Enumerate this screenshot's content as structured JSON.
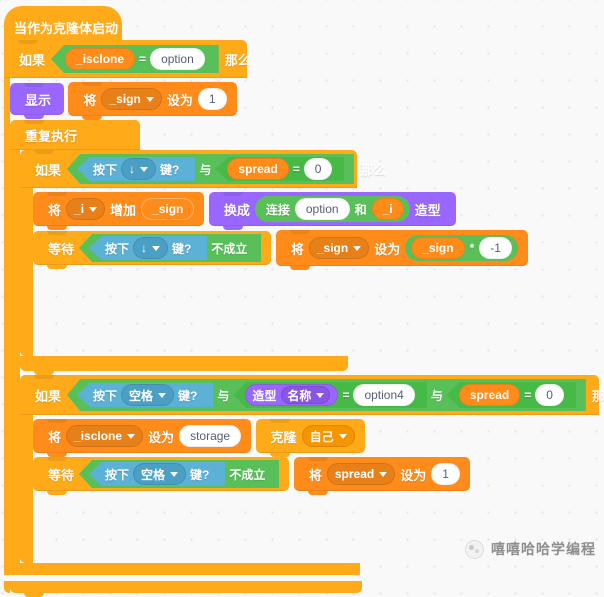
{
  "editor": {
    "name": "scratch-block-workspace",
    "background_color": "#f9f9f9",
    "grid_dot_color": "#e3e3e3"
  },
  "palette": {
    "control": "#ffab19",
    "control_dark": "#f59500",
    "variables": "#ff8c1a",
    "operators": "#59c059",
    "sensing": "#5cb1d6",
    "looks": "#9966ff",
    "white_field": "#ffffff"
  },
  "script": {
    "hat": {
      "label": "当作为克隆体启动时"
    },
    "if1": {
      "keyword_if": "如果",
      "keyword_then": "那么",
      "condition": {
        "left": "_isclone",
        "operator": "=",
        "right": "option"
      }
    },
    "show_block": {
      "label": "显示"
    },
    "set_sign_1": {
      "keyword_set": "将",
      "variable": "_sign",
      "keyword_to": "设为",
      "value": "1"
    },
    "forever": {
      "label": "重复执行"
    },
    "if2": {
      "keyword_if": "如果",
      "keyword_then": "那么",
      "keyword_and": "与",
      "key_pressed": {
        "prefix": "按下",
        "key": "↓",
        "suffix": "键?"
      },
      "equals": {
        "left": "spread",
        "operator": "=",
        "right": "0"
      }
    },
    "change_i": {
      "keyword_set": "将",
      "variable": "_i",
      "keyword_change": "增加",
      "value": "_sign"
    },
    "switch_costume": {
      "keyword_switch": "换成",
      "keyword_costume": "造型",
      "join": {
        "label": "连接",
        "a": "option",
        "and": "和",
        "b": "_i"
      }
    },
    "wait_until_1": {
      "keyword_wait": "等待",
      "key_pressed": {
        "prefix": "按下",
        "key": "↓",
        "suffix": "键?"
      },
      "keyword_not": "不成立"
    },
    "set_sign_mul": {
      "keyword_set": "将",
      "variable": "_sign",
      "keyword_to": "设为",
      "multiply": {
        "left": "_sign",
        "operator": "*",
        "right": "-1"
      }
    },
    "if3": {
      "keyword_if": "如果",
      "keyword_then": "那么",
      "keyword_and_1": "与",
      "keyword_and_2": "与",
      "key_pressed": {
        "prefix": "按下",
        "key": "空格",
        "suffix": "键?"
      },
      "costume_equals": {
        "costume_label": "造型",
        "costume_prop": "名称",
        "operator": "=",
        "right": "option4"
      },
      "spread_equals": {
        "left": "spread",
        "operator": "=",
        "right": "0"
      }
    },
    "set_isclone": {
      "keyword_set": "将",
      "variable": "_isclone",
      "keyword_to": "设为",
      "value": "storage"
    },
    "clone": {
      "keyword_clone": "克隆",
      "target": "自己"
    },
    "wait_until_2": {
      "keyword_wait": "等待",
      "key_pressed": {
        "prefix": "按下",
        "key": "空格",
        "suffix": "键?"
      },
      "keyword_not": "不成立"
    },
    "set_spread_1": {
      "keyword_set": "将",
      "variable": "spread",
      "keyword_to": "设为",
      "value": "1"
    }
  },
  "watermark": {
    "text": "嘻嘻哈哈学编程"
  }
}
